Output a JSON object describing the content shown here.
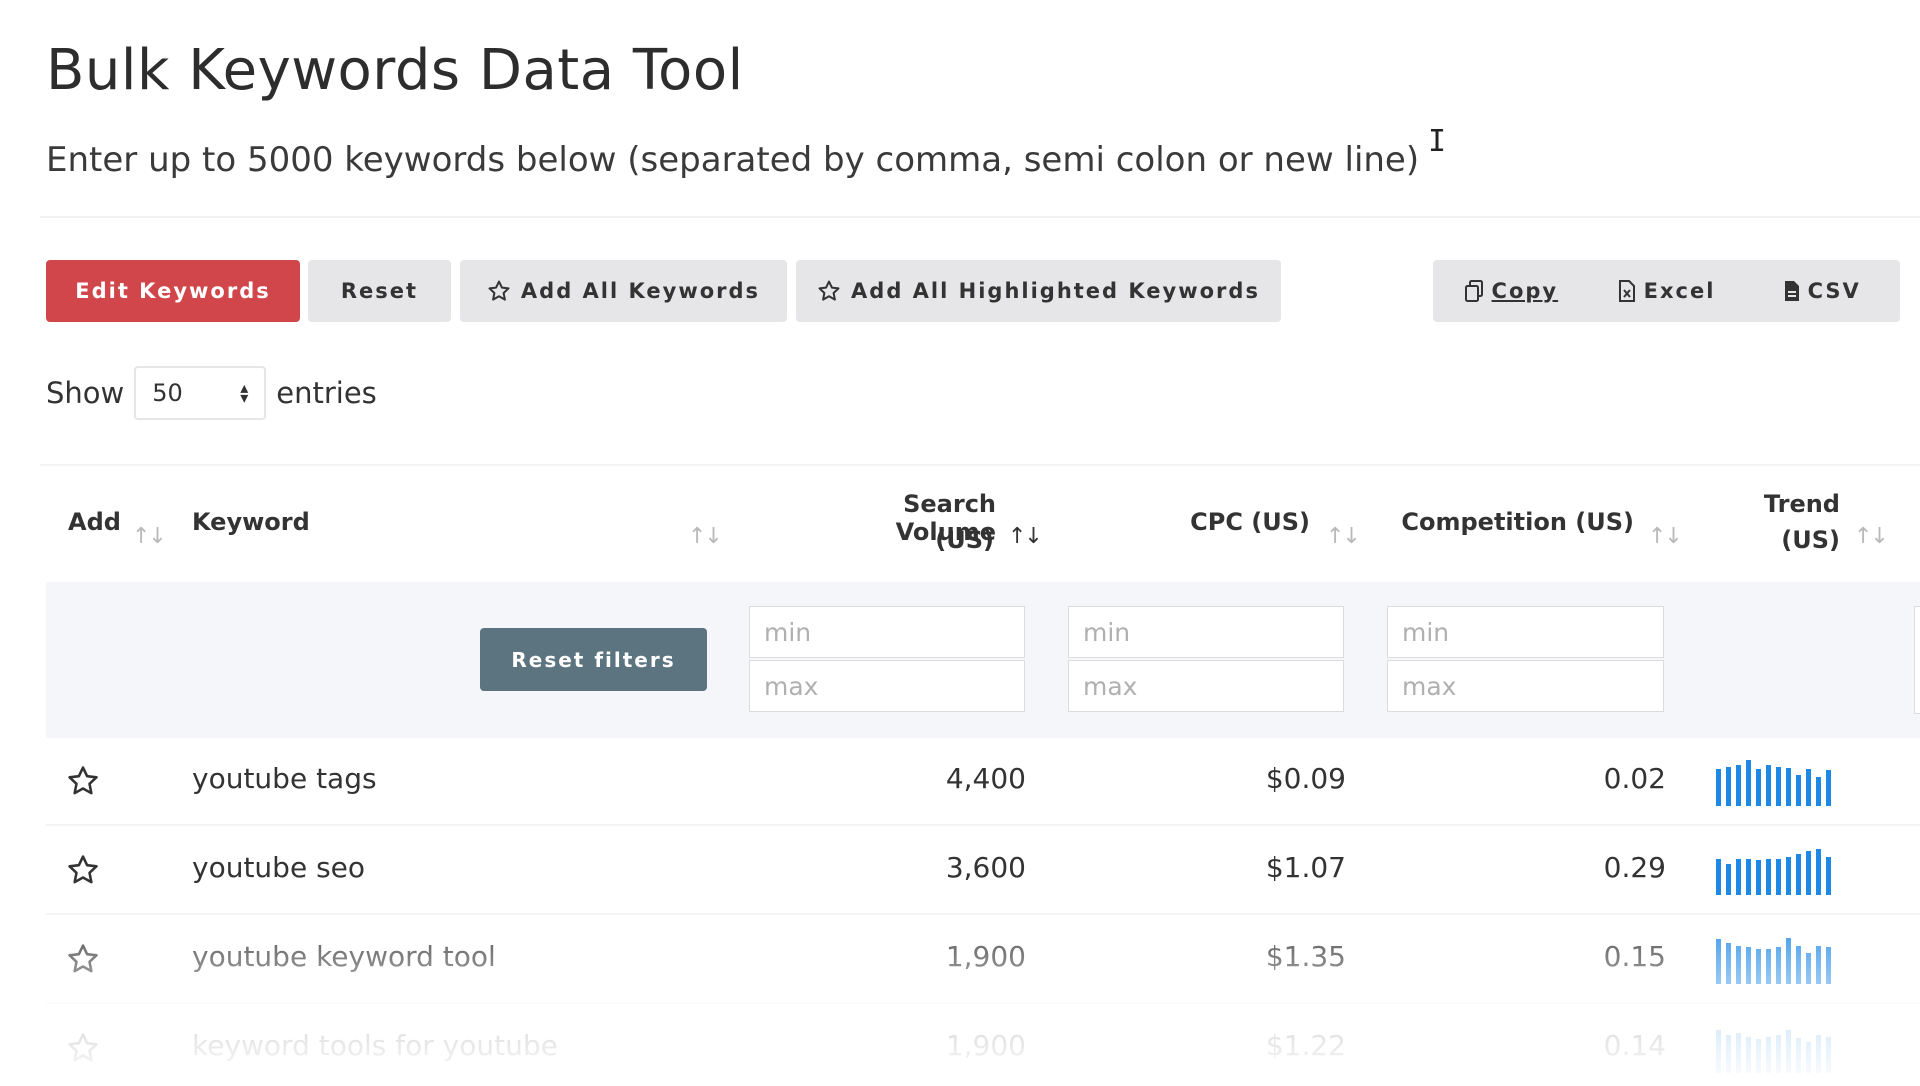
{
  "page": {
    "title": "Bulk Keywords Data Tool",
    "subtitle": "Enter up to 5000 keywords below (separated by comma, semi colon or new line)"
  },
  "toolbar": {
    "edit_keywords": "Edit Keywords",
    "reset": "Reset",
    "add_all": "Add All Keywords",
    "add_highlighted": "Add All Highlighted Keywords",
    "copy": "Copy",
    "excel": "Excel",
    "csv": "CSV"
  },
  "length": {
    "show_label": "Show",
    "value": "50",
    "entries_label": "entries"
  },
  "table": {
    "headers": {
      "add": "Add",
      "keyword": "Keyword",
      "volume_line1": "Search Volume",
      "volume_line2": "(US)",
      "cpc": "CPC (US)",
      "competition": "Competition (US)",
      "trend_line1": "Trend",
      "trend_line2": "(US)"
    },
    "filters": {
      "reset_label": "Reset filters",
      "min_placeholder": "min",
      "max_placeholder": "max"
    },
    "rows": [
      {
        "keyword": "youtube tags",
        "volume": "4,400",
        "cpc": "$0.09",
        "competition": "0.02",
        "trend": [
          0.78,
          0.82,
          0.86,
          0.96,
          0.78,
          0.86,
          0.82,
          0.8,
          0.64,
          0.78,
          0.6,
          0.74
        ]
      },
      {
        "keyword": "youtube seo",
        "volume": "3,600",
        "cpc": "$1.07",
        "competition": "0.29",
        "trend": [
          0.74,
          0.64,
          0.74,
          0.74,
          0.72,
          0.74,
          0.74,
          0.8,
          0.86,
          0.92,
          0.96,
          0.8
        ]
      },
      {
        "keyword": "youtube keyword tool",
        "volume": "1,900",
        "cpc": "$1.35",
        "competition": "0.15",
        "trend": [
          0.94,
          0.86,
          0.8,
          0.78,
          0.72,
          0.72,
          0.78,
          0.96,
          0.8,
          0.64,
          0.8,
          0.78
        ]
      },
      {
        "keyword": "keyword tools for youtube",
        "volume": "1,900",
        "cpc": "$1.22",
        "competition": "0.14",
        "trend": [
          0.9,
          0.8,
          0.84,
          0.74,
          0.7,
          0.74,
          0.8,
          0.9,
          0.72,
          0.64,
          0.8,
          0.76
        ]
      }
    ]
  },
  "colors": {
    "primary_button": "#d0464a",
    "secondary_button": "#e6e6e8",
    "reset_filters_button": "#5b7480",
    "trend_bar": "#1e88e5",
    "filter_band": "#f4f6fa"
  }
}
